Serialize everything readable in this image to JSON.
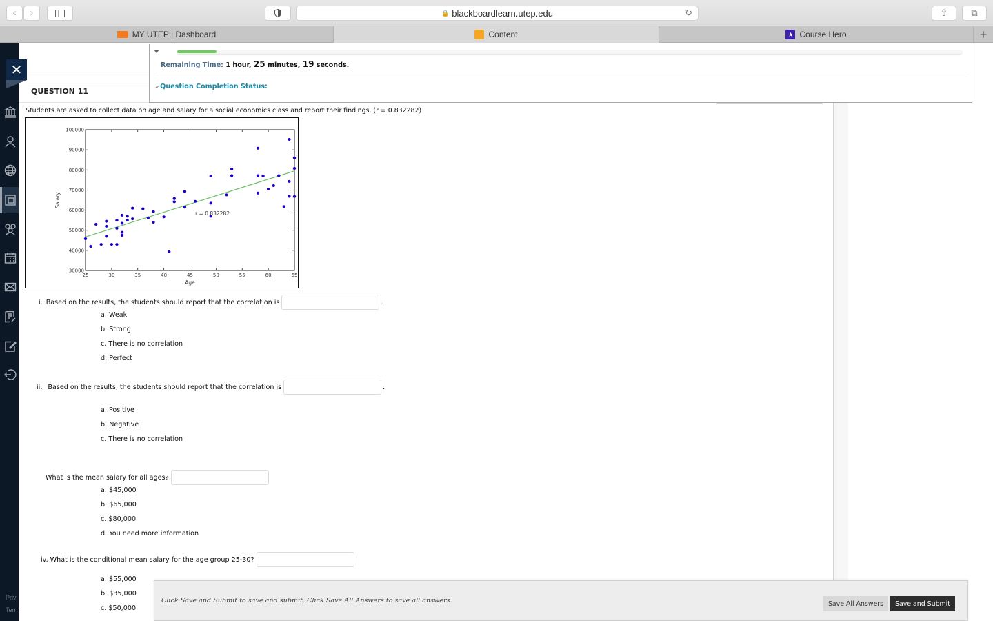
{
  "browser": {
    "url": "blackboardlearn.utep.edu",
    "tabs": [
      {
        "label": "MY UTEP | Dashboard",
        "icon": "utep-logo-icon",
        "active": false
      },
      {
        "label": "Content",
        "icon": "pencil-icon",
        "active": true
      },
      {
        "label": "Course Hero",
        "icon": "course-hero-star-icon",
        "active": false
      }
    ],
    "new_tab": "+"
  },
  "timer": {
    "label": "Remaining Time:",
    "hours": "1",
    "hours_unit": "hour,",
    "minutes": "25",
    "minutes_unit": "minutes,",
    "seconds": "19",
    "seconds_unit": "seconds.",
    "progress_fraction": 0.05,
    "completion_label": "Question Completion Status:"
  },
  "question": {
    "title": "QUESTION 11",
    "prompt": "Students are asked to collect data on age and salary for a social economics class and report their findings. (r = 0.832282)",
    "parts": [
      {
        "numeral": "i.",
        "text": "Based on the results, the students should report that the correlation is",
        "trailing": ".",
        "options": [
          "a.  Weak",
          "b.  Strong",
          "c.  There is no correlation",
          "d.  Perfect"
        ]
      },
      {
        "numeral": "ii.",
        "text": "Based on the results, the students should report that the correlation is",
        "trailing": ".",
        "options": [
          "a.  Positive",
          "b.  Negative",
          "c.  There is no correlation"
        ]
      },
      {
        "numeral": "",
        "text": "What is the mean salary for all ages?",
        "trailing": "",
        "options": [
          "a.  $45,000",
          "b.  $65,000",
          "c.  $80,000",
          "d.  You need more information"
        ]
      },
      {
        "numeral": "iv.",
        "text": "What is the conditional mean salary for the age group 25-30?",
        "trailing": "",
        "options": [
          "a.  $55,000",
          "b.  $35,000",
          "c.  $50,000"
        ]
      }
    ]
  },
  "footer": {
    "message": "Click Save and Submit to save and submit. Click Save All Answers to save all answers.",
    "save_all": "Save All Answers",
    "save_submit": "Save and Submit"
  },
  "leftnav": {
    "items": [
      "institution-icon",
      "profile-icon",
      "globe-icon",
      "courses-icon",
      "groups-icon",
      "calendar-icon",
      "messages-icon",
      "grades-icon",
      "tools-icon",
      "sign-out-icon"
    ],
    "active_index": 3,
    "legal": [
      "Priv",
      "Tern"
    ]
  },
  "chart_data": {
    "type": "scatter",
    "title": "",
    "xlabel": "Age",
    "ylabel": "Salary",
    "xlim": [
      25,
      65
    ],
    "ylim": [
      30000,
      100000
    ],
    "xticks": [
      25,
      30,
      35,
      40,
      45,
      50,
      55,
      60,
      65
    ],
    "yticks": [
      30000,
      40000,
      50000,
      60000,
      70000,
      80000,
      90000,
      100000
    ],
    "annotation": {
      "text": "r = 0.832282",
      "x": 46,
      "y": 58500
    },
    "grid": false,
    "point_color": "#1a00c8",
    "trend_color": "#6cc06c",
    "trendline": {
      "x": [
        25,
        65
      ],
      "y": [
        46700,
        79500
      ]
    },
    "points": [
      [
        25,
        45800
      ],
      [
        26,
        42000
      ],
      [
        27,
        53000
      ],
      [
        28,
        43000
      ],
      [
        29,
        54500
      ],
      [
        29,
        52000
      ],
      [
        29,
        47000
      ],
      [
        30,
        43000
      ],
      [
        31,
        55000
      ],
      [
        31,
        51000
      ],
      [
        31,
        43000
      ],
      [
        32,
        57500
      ],
      [
        32,
        53500
      ],
      [
        32,
        49000
      ],
      [
        32,
        47500
      ],
      [
        33,
        57000
      ],
      [
        33,
        55000
      ],
      [
        34,
        61000
      ],
      [
        34,
        55700
      ],
      [
        36,
        60700
      ],
      [
        37,
        56200
      ],
      [
        38,
        59300
      ],
      [
        38,
        54000
      ],
      [
        40,
        56700
      ],
      [
        41,
        39300
      ],
      [
        42,
        65800
      ],
      [
        42,
        64200
      ],
      [
        44,
        69300
      ],
      [
        44,
        61500
      ],
      [
        46,
        64400
      ],
      [
        49,
        77000
      ],
      [
        49,
        63500
      ],
      [
        49,
        57000
      ],
      [
        52,
        67600
      ],
      [
        53,
        80500
      ],
      [
        53,
        77200
      ],
      [
        58,
        90800
      ],
      [
        58,
        77200
      ],
      [
        58,
        68500
      ],
      [
        59,
        77000
      ],
      [
        60,
        70500
      ],
      [
        61,
        72200
      ],
      [
        62,
        77200
      ],
      [
        63,
        61800
      ],
      [
        64,
        95200
      ],
      [
        64,
        74300
      ],
      [
        64,
        66900
      ],
      [
        65,
        86000
      ],
      [
        65,
        80800
      ],
      [
        65,
        66800
      ]
    ]
  }
}
